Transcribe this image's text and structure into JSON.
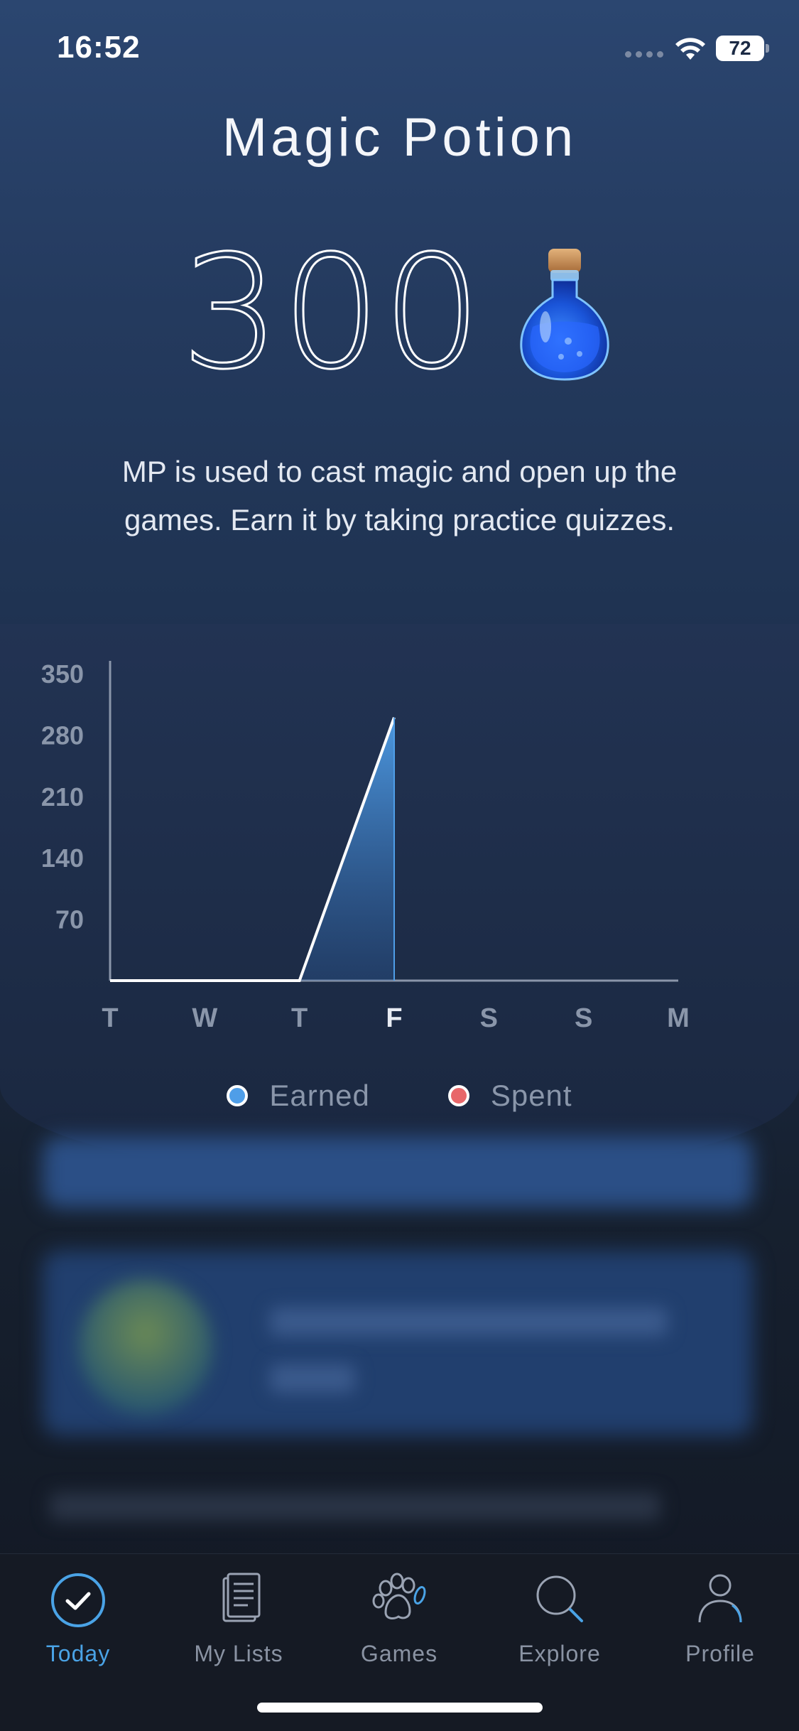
{
  "status_bar": {
    "time": "16:52",
    "battery": "72"
  },
  "header": {
    "title": "Magic Potion",
    "amount": "300",
    "icon": "potion-icon",
    "description": "MP is used to cast magic and open up the games. Earn it by taking practice quizzes."
  },
  "chart_data": {
    "type": "area",
    "categories": [
      "T",
      "W",
      "T",
      "F",
      "S",
      "S",
      "M"
    ],
    "highlighted_category": "F",
    "series": [
      {
        "name": "Earned",
        "values": [
          0,
          0,
          0,
          300,
          null,
          null,
          null
        ],
        "color": "#4f9ee8"
      },
      {
        "name": "Spent",
        "values": [
          0,
          0,
          0,
          0,
          null,
          null,
          null
        ],
        "color": "#e8676a"
      }
    ],
    "y_ticks": [
      70,
      140,
      210,
      280,
      350
    ],
    "ylim": [
      0,
      350
    ],
    "grid": true,
    "legend_position": "bottom"
  },
  "legend": {
    "earned": "Earned",
    "spent": "Spent"
  },
  "tabs": [
    {
      "label": "Today",
      "icon": "check-circle-icon",
      "active": true
    },
    {
      "label": "My Lists",
      "icon": "lists-icon",
      "active": false
    },
    {
      "label": "Games",
      "icon": "paw-icon",
      "active": false
    },
    {
      "label": "Explore",
      "icon": "search-icon",
      "active": false
    },
    {
      "label": "Profile",
      "icon": "person-icon",
      "active": false
    }
  ],
  "colors": {
    "accent": "#4aa3e6",
    "earned": "#4f9ee8",
    "spent": "#e8676a"
  }
}
